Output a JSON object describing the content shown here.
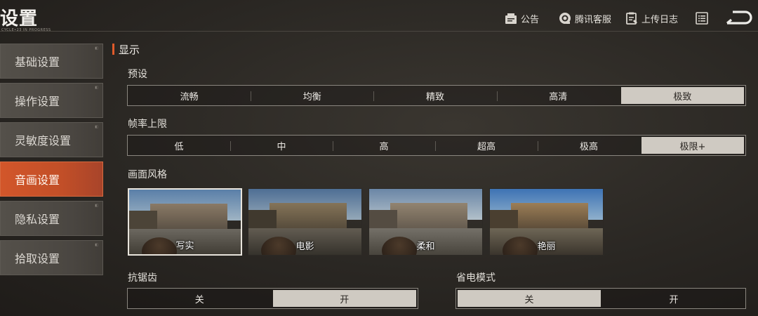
{
  "header": {
    "title": "设置",
    "subtitle": "CYCLE•23 IN PROGRESS",
    "notice_label": "公告",
    "service_label": "腾讯客服",
    "upload_label": "上传日志"
  },
  "sidebar": {
    "items": [
      {
        "label": "基础设置",
        "active": false
      },
      {
        "label": "操作设置",
        "active": false
      },
      {
        "label": "灵敏度设置",
        "active": false
      },
      {
        "label": "音画设置",
        "active": true
      },
      {
        "label": "隐私设置",
        "active": false
      },
      {
        "label": "拾取设置",
        "active": false
      }
    ]
  },
  "main": {
    "section_title": "显示",
    "preset": {
      "label": "预设",
      "options": [
        "流畅",
        "均衡",
        "精致",
        "高清",
        "极致"
      ],
      "selected": "极致"
    },
    "fps": {
      "label": "帧率上限",
      "options": [
        "低",
        "中",
        "高",
        "超高",
        "极高",
        "极限+"
      ],
      "selected": "极限+"
    },
    "style": {
      "label": "画面风格",
      "options": [
        "写实",
        "电影",
        "柔和",
        "艳丽"
      ],
      "selected": "写实"
    },
    "antialias": {
      "label": "抗锯齿",
      "options": [
        "关",
        "开"
      ],
      "selected": "开"
    },
    "powersave": {
      "label": "省电模式",
      "options": [
        "关",
        "开"
      ],
      "selected": "关"
    }
  },
  "colors": {
    "accent": "#e05a2a",
    "active_tab": "#c9532a",
    "selected_option": "#cfcac2"
  },
  "icons": [
    "notice-icon",
    "headset-icon",
    "log-icon",
    "list-icon",
    "back-icon"
  ]
}
